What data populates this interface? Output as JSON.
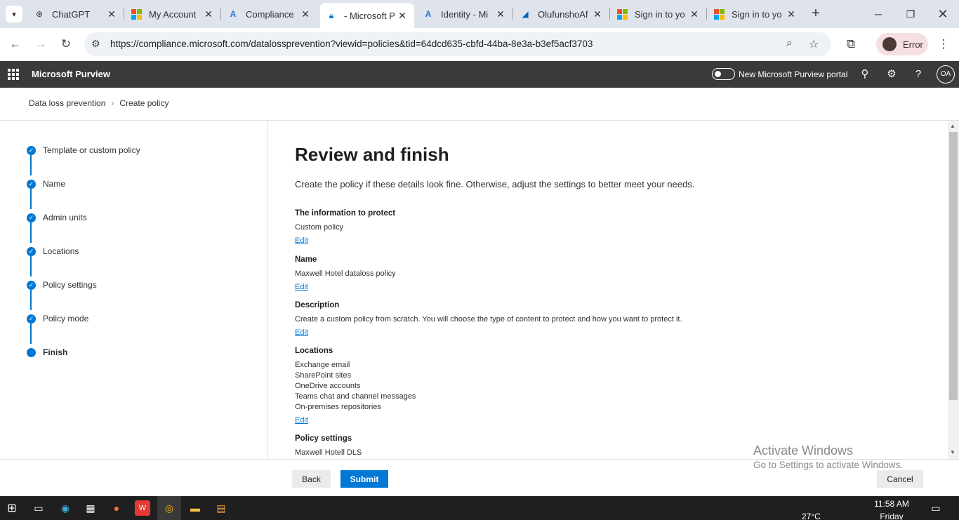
{
  "browser": {
    "tabs": [
      {
        "title": "ChatGPT",
        "icon": "chatgpt-icon"
      },
      {
        "title": "My Account",
        "icon": "microsoft-logo-icon"
      },
      {
        "title": "Compliance",
        "icon": "azure-icon"
      },
      {
        "title": "- Microsoft P",
        "icon": "lock-icon",
        "active": true
      },
      {
        "title": "Identity - Mi",
        "icon": "azure-icon"
      },
      {
        "title": "OlufunshoAf",
        "icon": "onedrive-icon"
      },
      {
        "title": "Sign in to yo",
        "icon": "microsoft-logo-icon"
      },
      {
        "title": "Sign in to yo",
        "icon": "microsoft-logo-icon"
      }
    ],
    "url": "https://compliance.microsoft.com/datalossprevention?viewid=policies&tid=64dcd635-cbfd-44ba-8e3a-b3ef5acf3703",
    "profile_label": "Error"
  },
  "app": {
    "name": "Microsoft Purview",
    "toggle_label": "New Microsoft Purview portal",
    "avatar_initials": "OA"
  },
  "breadcrumb": {
    "root": "Data loss prevention",
    "current": "Create policy"
  },
  "steps": [
    {
      "label": "Template or custom policy",
      "done": true
    },
    {
      "label": "Name",
      "done": true
    },
    {
      "label": "Admin units",
      "done": true
    },
    {
      "label": "Locations",
      "done": true
    },
    {
      "label": "Policy settings",
      "done": true
    },
    {
      "label": "Policy mode",
      "done": true
    },
    {
      "label": "Finish",
      "done": false,
      "current": true
    }
  ],
  "review": {
    "title": "Review and finish",
    "intro": "Create the policy if these details look fine. Otherwise, adjust the settings to better meet your needs.",
    "edit_label": "Edit",
    "sections": [
      {
        "title": "The information to protect",
        "lines": [
          "Custom policy"
        ]
      },
      {
        "title": "Name",
        "lines": [
          "Maxwell Hotel dataloss policy"
        ]
      },
      {
        "title": "Description",
        "lines": [
          "Create a custom policy from scratch. You will choose the type of content to protect and how you want to protect it."
        ]
      },
      {
        "title": "Locations",
        "lines": [
          "Exchange email",
          "SharePoint sites",
          "OneDrive accounts",
          "Teams chat and channel messages",
          "On-premises repositories"
        ]
      },
      {
        "title": "Policy settings",
        "lines": [
          "Maxwell Hotell DLS"
        ]
      }
    ]
  },
  "footer": {
    "back_label": "Back",
    "submit_label": "Submit",
    "cancel_label": "Cancel"
  },
  "watermark": {
    "line1": "Activate Windows",
    "line2": "Go to Settings to activate Windows."
  },
  "taskbar": {
    "time": "11:58 AM",
    "day": "Friday",
    "temperature": "27°C"
  },
  "colors": {
    "accent": "#0078d4",
    "header_bg": "#3b3a39"
  }
}
